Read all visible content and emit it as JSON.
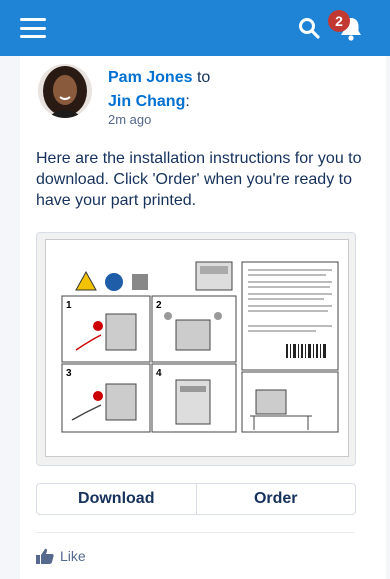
{
  "header": {
    "notification_count": "2",
    "icons": [
      "menu-icon",
      "search-icon",
      "bell-icon"
    ],
    "brand_color": "#1f83d6",
    "badge_color": "#c23934"
  },
  "post": {
    "author": "Pam Jones",
    "connector": "to",
    "recipient": "Jin Chang",
    "recipient_suffix": ":",
    "timestamp": "2m ago",
    "body": "Here are the installation instructions for you to download. Click 'Order' when you're ready to have your part printed."
  },
  "actions": {
    "download_label": "Download",
    "order_label": "Order"
  },
  "footer": {
    "like_label": "Like"
  }
}
